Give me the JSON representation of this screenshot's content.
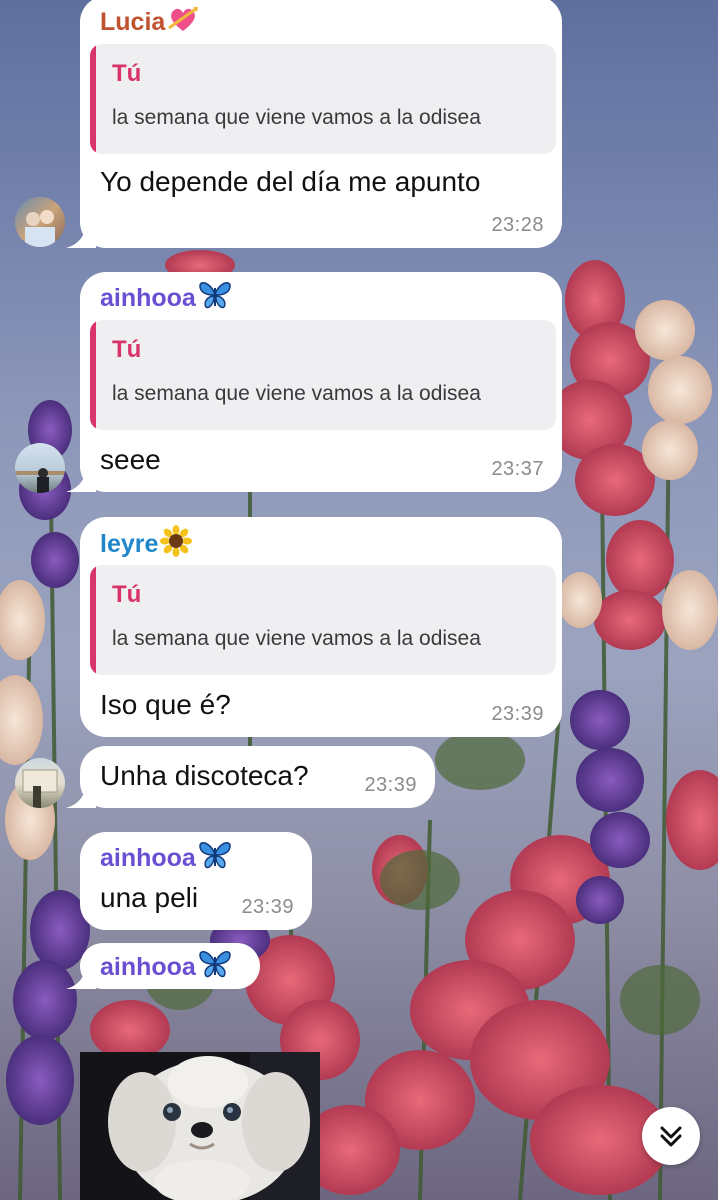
{
  "colors": {
    "quote_accent": "#d8336a",
    "lucia": "#c0532f",
    "ainhooa": "#6a4fd2",
    "leyre": "#1f87c9",
    "bubble": "#ffffff",
    "timestamp": "#8a8a8e"
  },
  "messages": [
    {
      "sender": "Lucia",
      "sender_emoji": "heart-with-arrow-icon",
      "reply": {
        "author": "Tú",
        "text": "la semana que viene vamos a la odisea"
      },
      "text": "Yo depende del día me apunto",
      "time": "23:28"
    },
    {
      "sender": "ainhooa",
      "sender_emoji": "butterfly-icon",
      "reply": {
        "author": "Tú",
        "text": "la semana que viene vamos a la odisea"
      },
      "text": "seee",
      "time": "23:37"
    },
    {
      "sender": "leyre",
      "sender_emoji": "sunflower-icon",
      "reply": {
        "author": "Tú",
        "text": "la semana que viene vamos a la odisea"
      },
      "text": "Iso que é?",
      "time": "23:39"
    },
    {
      "text": "Unha discoteca?",
      "time": "23:39"
    },
    {
      "sender": "ainhooa",
      "sender_emoji": "butterfly-icon",
      "text": "una peli",
      "time": "23:39"
    },
    {
      "sender": "ainhooa",
      "sender_emoji": "butterfly-icon"
    }
  ],
  "attachment": {
    "icon": "dog-photo"
  },
  "scroll_button": {
    "icon": "double-chevron-down-icon"
  }
}
